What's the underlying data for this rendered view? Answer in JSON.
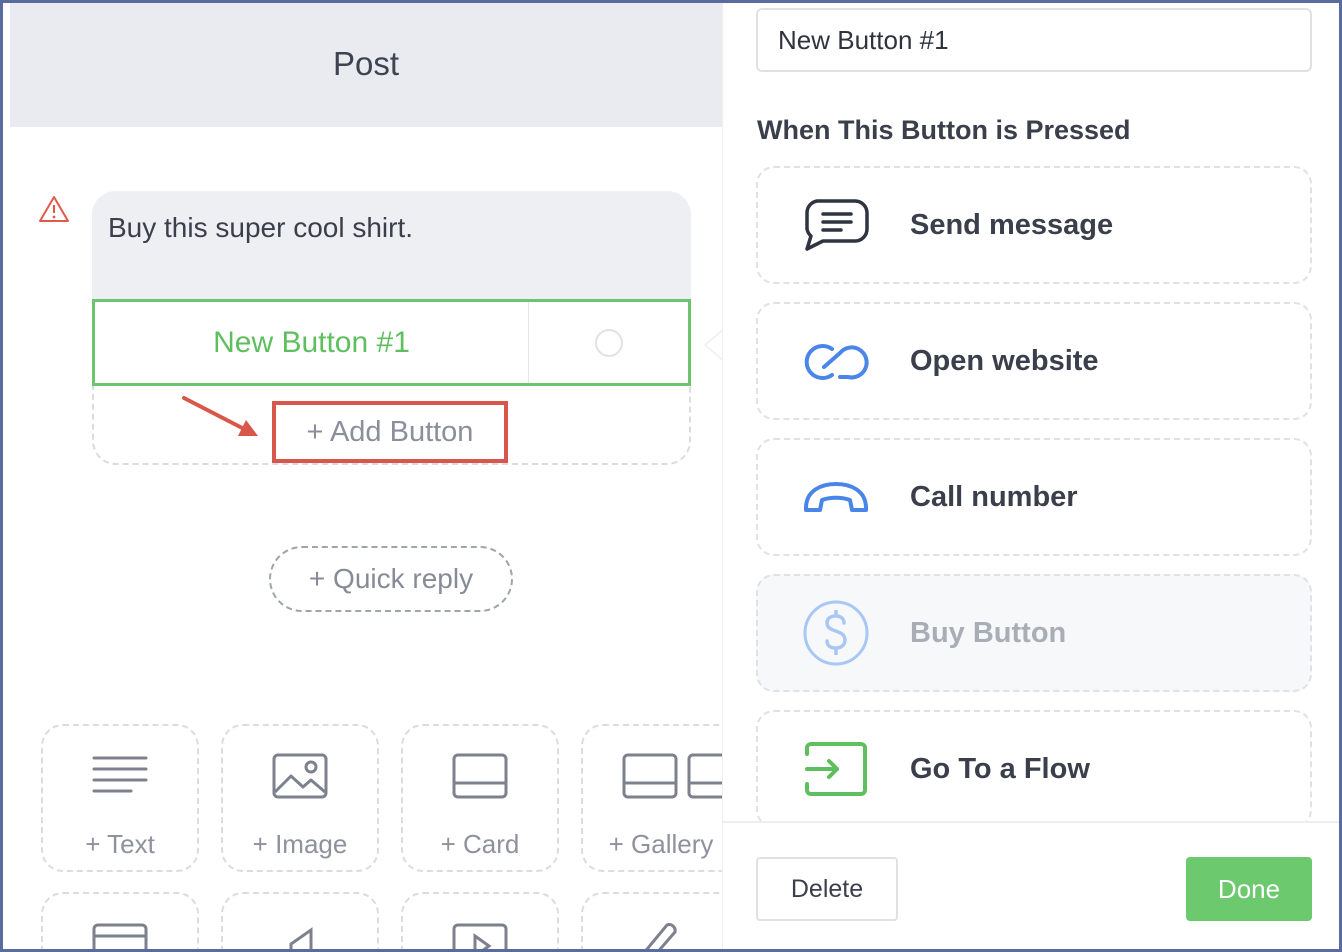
{
  "post": {
    "title": "Post",
    "message_text": "Buy this super cool shirt.",
    "button_label": "New Button #1",
    "add_button_label": "+ Add Button",
    "quick_reply_label": "+ Quick reply"
  },
  "content_tiles": [
    {
      "label": "+ Text",
      "icon": "text-lines-icon"
    },
    {
      "label": "+ Image",
      "icon": "image-icon"
    },
    {
      "label": "+ Card",
      "icon": "card-icon"
    },
    {
      "label": "+ Gallery",
      "icon": "gallery-icon"
    }
  ],
  "content_tiles_row2_icons": [
    "table-icon",
    "audio-icon",
    "video-icon",
    "attachment-icon"
  ],
  "editor": {
    "button_name_value": "New Button #1",
    "section_title": "When This Button is Pressed",
    "actions": [
      {
        "label": "Send message",
        "icon": "chat-bubble-icon",
        "enabled": true
      },
      {
        "label": "Open website",
        "icon": "link-icon",
        "enabled": true
      },
      {
        "label": "Call number",
        "icon": "phone-icon",
        "enabled": true
      },
      {
        "label": "Buy Button",
        "icon": "dollar-icon",
        "enabled": false
      },
      {
        "label": "Go To a Flow",
        "icon": "flow-arrow-icon",
        "enabled": true
      }
    ],
    "delete_label": "Delete",
    "done_label": "Done"
  },
  "colors": {
    "accent_green": "#6cc96e",
    "highlight_red": "#d9574a",
    "icon_blue": "#4a86e8",
    "header_bg": "#e9ebf1"
  }
}
